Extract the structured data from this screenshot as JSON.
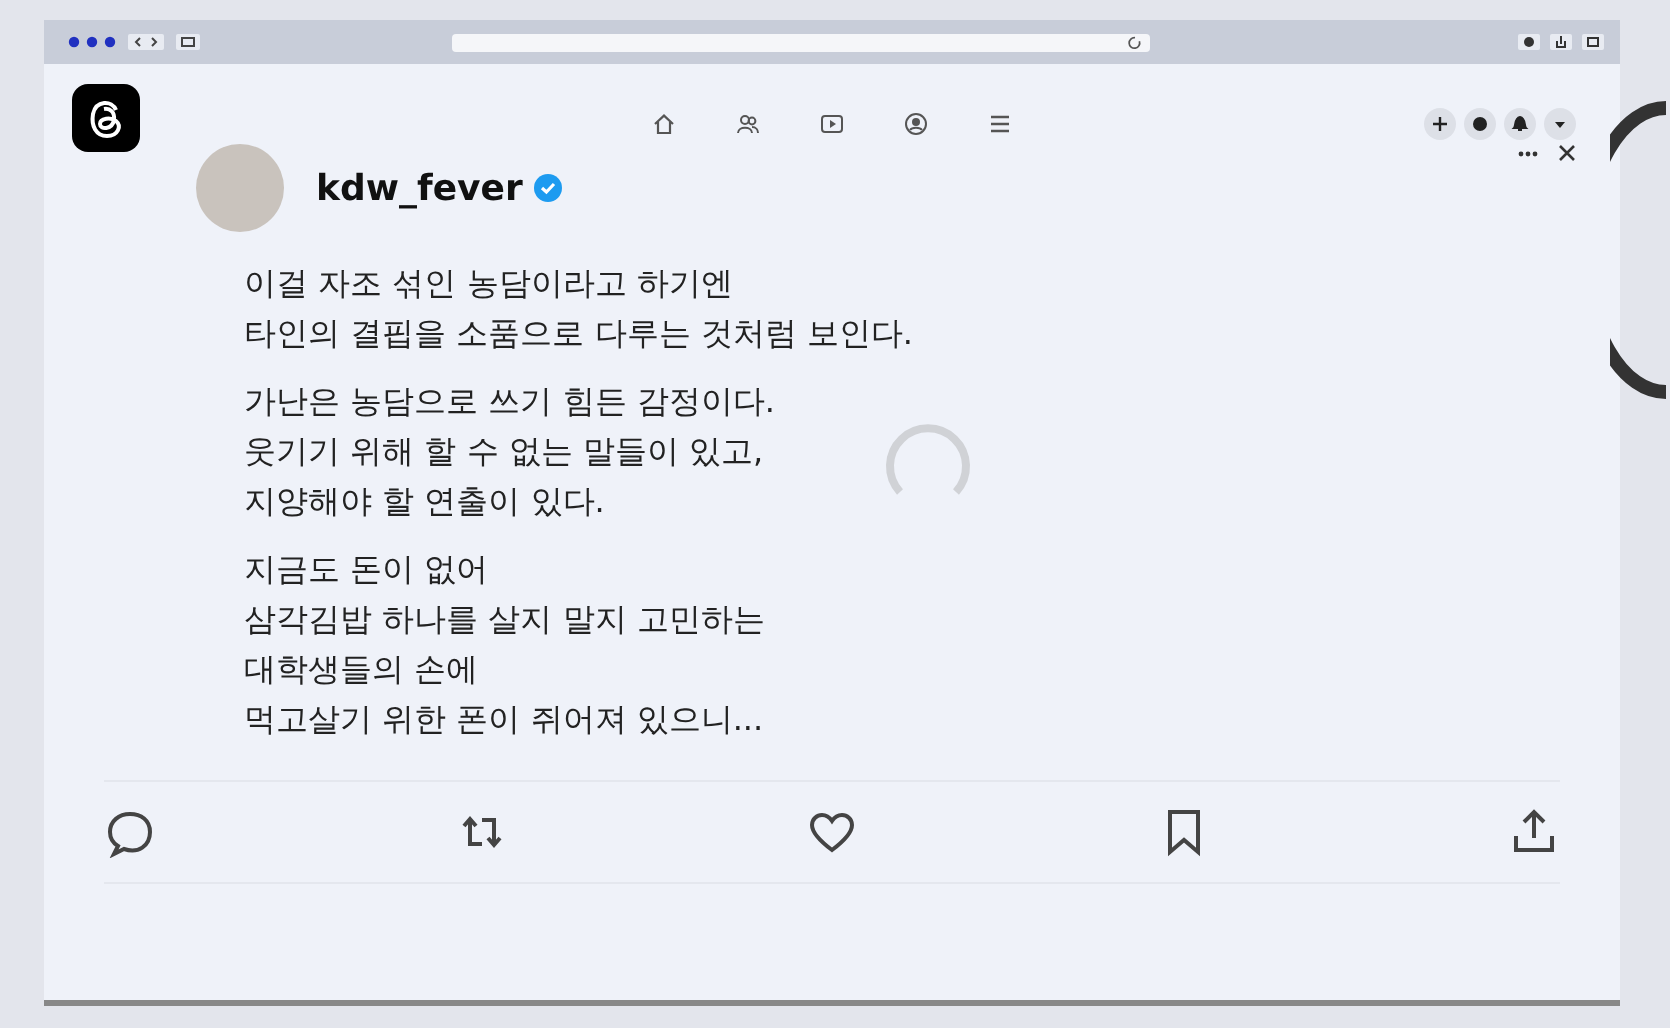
{
  "post": {
    "username": "kdw_fever",
    "verified": true,
    "paragraphs": [
      [
        "이걸 자조 섞인 농담이라고 하기엔",
        "타인의 결핍을 소품으로 다루는 것처럼 보인다."
      ],
      [
        "가난은 농담으로 쓰기 힘든 감정이다.",
        "웃기기 위해 할 수 없는 말들이 있고,",
        "지양해야 할 연출이 있다."
      ],
      [
        "지금도 돈이 없어",
        "삼각김밥 하나를 살지 말지 고민하는",
        "대학생들의 손에",
        "먹고살기 위한 폰이 쥐어져 있으니..."
      ]
    ]
  },
  "loading": true
}
